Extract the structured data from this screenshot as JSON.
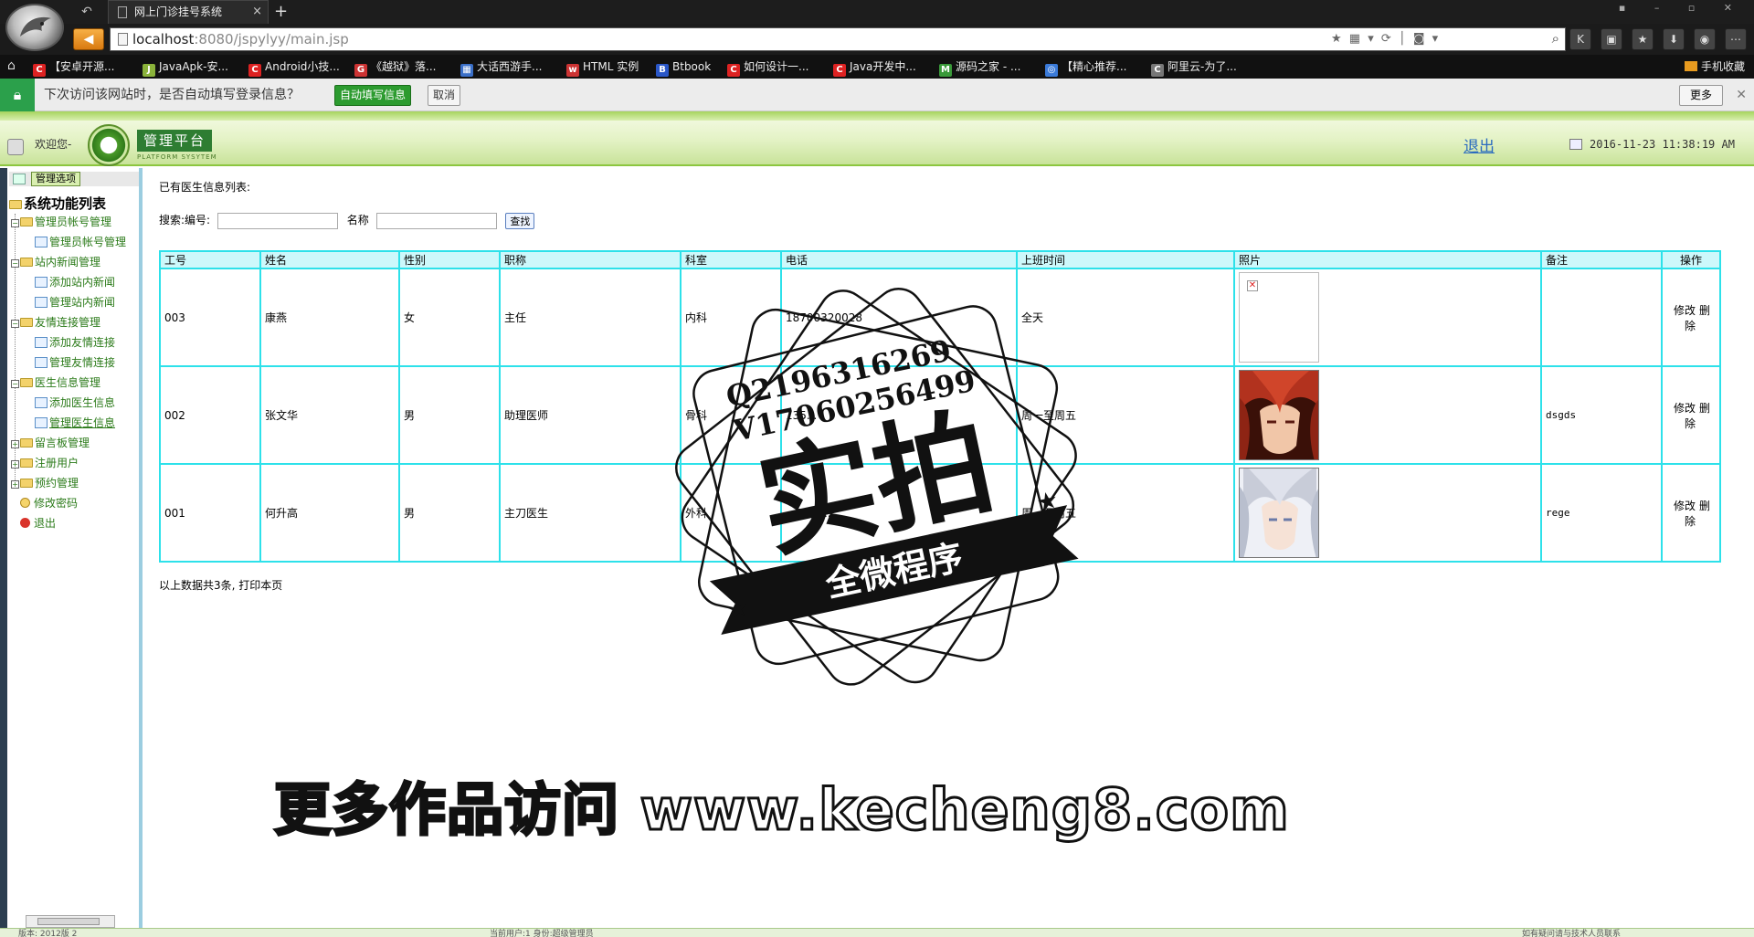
{
  "browser": {
    "tab_title": "网上门诊挂号系统",
    "url_host": "localhost",
    "url_rest": ":8080/jspylyy/main.jsp",
    "bookmarks": [
      {
        "label": "【安卓开源...",
        "color": "#d22"
      },
      {
        "label": "JavaApk-安...",
        "color": "#8ab23a"
      },
      {
        "label": "Android小技...",
        "color": "#d22"
      },
      {
        "label": "《越狱》落...",
        "color": "#c33"
      },
      {
        "label": "大话西游手...",
        "color": "#3a6fc8"
      },
      {
        "label": "HTML 实例",
        "color": "#c33"
      },
      {
        "label": "Btbook",
        "color": "#2a57c8"
      },
      {
        "label": "如何设计一...",
        "color": "#d22"
      },
      {
        "label": "Java开发中...",
        "color": "#d22"
      },
      {
        "label": "源码之家 - ...",
        "color": "#3a9a3a"
      },
      {
        "label": "【精心推荐...",
        "color": "#3a7ad8"
      },
      {
        "label": "阿里云-为了...",
        "color": "#777"
      }
    ],
    "mobile_favorites": "手机收藏",
    "notification": {
      "text": "下次访问该网站时，是否自动填写登录信息？",
      "autofill_label": "自动填写信息",
      "cancel_label": "取消",
      "more_label": "更多"
    }
  },
  "header": {
    "welcome": "欢迎您-",
    "logo_title": "管理平台",
    "logo_subtitle": "PLATFORM SYSYTEM",
    "logout": "退出",
    "datetime": "2016-11-23 11:38:19 AM"
  },
  "sidebar": {
    "header_label": "管理选项",
    "root_label": "系统功能列表",
    "groups": [
      {
        "label": "管理员帐号管理",
        "children": [
          "管理员帐号管理"
        ]
      },
      {
        "label": "站内新闻管理",
        "children": [
          "添加站内新闻",
          "管理站内新闻"
        ]
      },
      {
        "label": "友情连接管理",
        "children": [
          "添加友情连接",
          "管理友情连接"
        ]
      },
      {
        "label": "医生信息管理",
        "children": [
          "添加医生信息",
          "管理医生信息"
        ]
      },
      {
        "label": "留言板管理",
        "children": []
      },
      {
        "label": "注册用户",
        "children": []
      },
      {
        "label": "预约管理",
        "children": []
      }
    ],
    "change_password": "修改密码",
    "exit": "退出"
  },
  "main": {
    "title": "已有医生信息列表:",
    "search_label": "搜索:编号:",
    "name_label": "名称",
    "search_button": "查找",
    "columns": [
      "工号",
      "姓名",
      "性别",
      "职称",
      "科室",
      "电话",
      "上班时间",
      "照片",
      "备注",
      "操作"
    ],
    "rows": [
      {
        "id": "003",
        "name": "康燕",
        "gender": "女",
        "title": "主任",
        "dept": "内科",
        "phone": "18700320028",
        "schedule": "全天",
        "photo": "broken",
        "note": "",
        "edit": "修改",
        "delete": "删除"
      },
      {
        "id": "002",
        "name": "张文华",
        "gender": "男",
        "title": "助理医师",
        "dept": "骨科",
        "phone": "135...",
        "schedule": "周一至周五",
        "photo": "red-hair",
        "note": "dsgds",
        "edit": "修改",
        "delete": "删除"
      },
      {
        "id": "001",
        "name": "何升高",
        "gender": "男",
        "title": "主刀医生",
        "dept": "外科",
        "phone": "...3164...",
        "schedule": "周一至周五",
        "photo": "silver-hair",
        "note": "rege",
        "edit": "修改",
        "delete": "删除"
      }
    ],
    "footer": "以上数据共3条, 打印本页"
  },
  "statusbar": {
    "left": "版本: 2012版 2",
    "center": "当前用户:1      身份:超级管理员",
    "right": "如有疑问请与技术人员联系"
  },
  "watermarks": {
    "stamp_line1": "Q2196316269",
    "stamp_line2": "V17060256499",
    "stamp_big": "实拍",
    "stamp_banner": "全微程序",
    "bottom": "更多作品访问 www.kecheng8.com"
  }
}
